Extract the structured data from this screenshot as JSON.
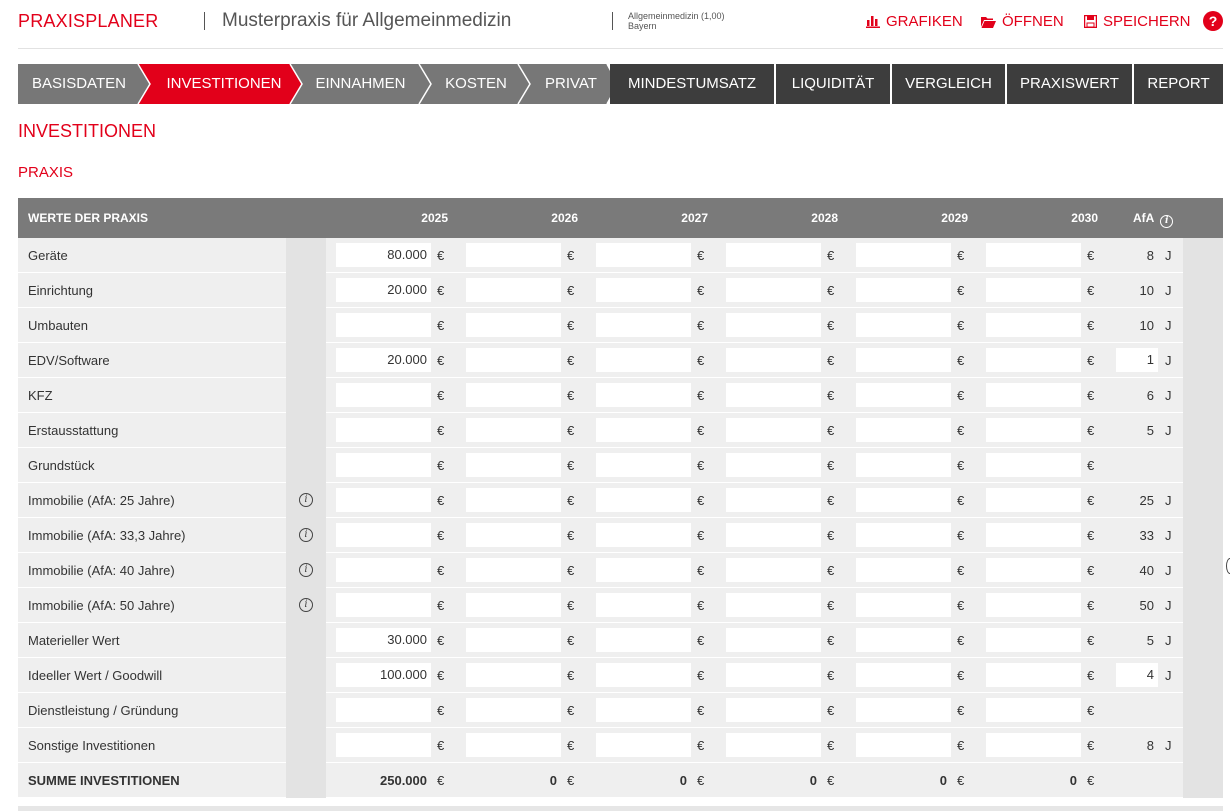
{
  "header": {
    "brand": "PRAXISPLANER",
    "practice_name": "Musterpraxis für Allgemeinmedizin",
    "meta_line1": "Allgemeinmedizin (1,00)",
    "meta_line2": "Bayern",
    "actions": [
      {
        "label": "GRAFIKEN",
        "icon": "bar-chart-icon"
      },
      {
        "label": "ÖFFNEN",
        "icon": "folder-icon"
      },
      {
        "label": "SPEICHERN",
        "icon": "save-icon"
      }
    ],
    "help_label": "?"
  },
  "nav": {
    "tabs": [
      "BASISDATEN",
      "INVESTITIONEN",
      "EINNAHMEN",
      "KOSTEN",
      "PRIVAT",
      "MINDESTUMSATZ",
      "LIQUIDITÄT",
      "VERGLEICH",
      "PRAXISWERT",
      "REPORT"
    ],
    "active": "INVESTITIONEN"
  },
  "page_title": "INVESTITIONEN",
  "section_title": "PRAXIS",
  "table": {
    "header_label": "WERTE DER PRAXIS",
    "years": [
      "2025",
      "2026",
      "2027",
      "2028",
      "2029",
      "2030"
    ],
    "afa_header": "AfA",
    "currency": "€",
    "afa_unit": "J",
    "rows": [
      {
        "label": "Geräte",
        "values": [
          "80.000",
          "",
          "",
          "",
          "",
          ""
        ],
        "afa": "8",
        "info": false,
        "afa_box": false
      },
      {
        "label": "Einrichtung",
        "values": [
          "20.000",
          "",
          "",
          "",
          "",
          ""
        ],
        "afa": "10",
        "info": false,
        "afa_box": false
      },
      {
        "label": "Umbauten",
        "values": [
          "",
          "",
          "",
          "",
          "",
          ""
        ],
        "afa": "10",
        "info": false,
        "afa_box": false
      },
      {
        "label": "EDV/Software",
        "values": [
          "20.000",
          "",
          "",
          "",
          "",
          ""
        ],
        "afa": "1",
        "info": false,
        "afa_box": true
      },
      {
        "label": "KFZ",
        "values": [
          "",
          "",
          "",
          "",
          "",
          ""
        ],
        "afa": "6",
        "info": false,
        "afa_box": false
      },
      {
        "label": "Erstausstattung",
        "values": [
          "",
          "",
          "",
          "",
          "",
          ""
        ],
        "afa": "5",
        "info": false,
        "afa_box": false
      },
      {
        "label": "Grundstück",
        "values": [
          "",
          "",
          "",
          "",
          "",
          ""
        ],
        "afa": "",
        "info": false,
        "afa_box": false
      },
      {
        "label": "Immobilie (AfA: 25 Jahre)",
        "values": [
          "",
          "",
          "",
          "",
          "",
          ""
        ],
        "afa": "25",
        "info": true,
        "afa_box": false
      },
      {
        "label": "Immobilie (AfA: 33,3 Jahre)",
        "values": [
          "",
          "",
          "",
          "",
          "",
          ""
        ],
        "afa": "33",
        "info": true,
        "afa_box": false
      },
      {
        "label": "Immobilie (AfA: 40 Jahre)",
        "values": [
          "",
          "",
          "",
          "",
          "",
          ""
        ],
        "afa": "40",
        "info": true,
        "afa_box": false
      },
      {
        "label": "Immobilie (AfA: 50 Jahre)",
        "values": [
          "",
          "",
          "",
          "",
          "",
          ""
        ],
        "afa": "50",
        "info": true,
        "afa_box": false
      },
      {
        "label": "Materieller Wert",
        "values": [
          "30.000",
          "",
          "",
          "",
          "",
          ""
        ],
        "afa": "5",
        "info": false,
        "afa_box": false
      },
      {
        "label": "Ideeller Wert / Goodwill",
        "values": [
          "100.000",
          "",
          "",
          "",
          "",
          ""
        ],
        "afa": "4",
        "info": false,
        "afa_box": true
      },
      {
        "label": "Dienstleistung / Gründung",
        "values": [
          "",
          "",
          "",
          "",
          "",
          ""
        ],
        "afa": "",
        "info": false,
        "afa_box": false
      },
      {
        "label": "Sonstige Investitionen",
        "values": [
          "",
          "",
          "",
          "",
          "",
          ""
        ],
        "afa": "8",
        "info": false,
        "afa_box": false
      }
    ],
    "sum": {
      "label": "SUMME INVESTITIONEN",
      "values": [
        "250.000",
        "0",
        "0",
        "0",
        "0",
        "0"
      ]
    }
  },
  "colors": {
    "accent": "#e2001a",
    "nav_inactive": "#777777",
    "nav_dark": "#3d3d3d",
    "table_header": "#7a7a7a"
  }
}
